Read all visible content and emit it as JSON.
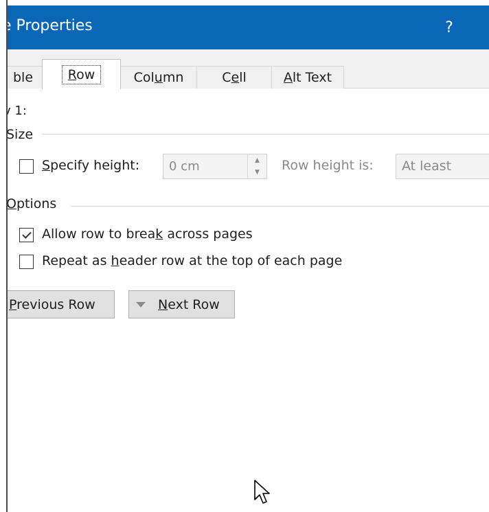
{
  "window": {
    "title": "e Properties",
    "help_label": "?"
  },
  "tabs": [
    {
      "label": "ble",
      "active": false
    },
    {
      "label": "Row",
      "active": true
    },
    {
      "label": "Column",
      "active": false
    },
    {
      "label": "Cell",
      "active": false
    },
    {
      "label": "Alt Text",
      "active": false
    }
  ],
  "row_panel": {
    "row_label": "v 1:",
    "size": {
      "heading": "Size",
      "specify_height_label": "Specify height:",
      "specify_height_checked": false,
      "height_value": "0 cm",
      "row_height_is_label": "Row height is:",
      "row_height_is_value": "At least"
    },
    "options": {
      "heading": "Options",
      "allow_break_label": "Allow row to break across pages",
      "allow_break_checked": true,
      "repeat_header_label": "Repeat as header row at the top of each page",
      "repeat_header_checked": false
    },
    "nav": {
      "previous_label": "Previous Row",
      "next_label": "Next Row"
    }
  },
  "icons": {
    "spin_up": "spin-up-arrow-icon",
    "spin_down": "spin-down-arrow-icon",
    "next_row": "triangle-down-icon",
    "cursor": "mouse-pointer-icon"
  }
}
